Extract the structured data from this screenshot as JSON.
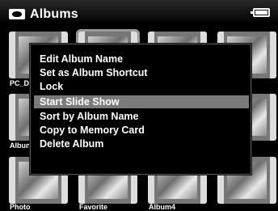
{
  "header": {
    "title": "Albums",
    "icon": "album-icon",
    "battery": "battery-icon"
  },
  "albums": [
    {
      "label": "PC_D"
    },
    {
      "label": ""
    },
    {
      "label": ""
    },
    {
      "label": ""
    },
    {
      "label": "Albun"
    },
    {
      "label": ""
    },
    {
      "label": ""
    },
    {
      "label": ""
    },
    {
      "label": "Photo"
    },
    {
      "label": "Favorite"
    },
    {
      "label": "Album4"
    },
    {
      "label": ""
    }
  ],
  "menu": {
    "items": [
      {
        "label": "Edit Album Name"
      },
      {
        "label": "Set as Album Shortcut"
      },
      {
        "label": "Lock"
      },
      {
        "label": "Start Slide Show",
        "highlighted": true
      },
      {
        "label": "Sort by Album Name"
      },
      {
        "label": "Copy to Memory Card"
      },
      {
        "label": "Delete Album"
      }
    ]
  }
}
